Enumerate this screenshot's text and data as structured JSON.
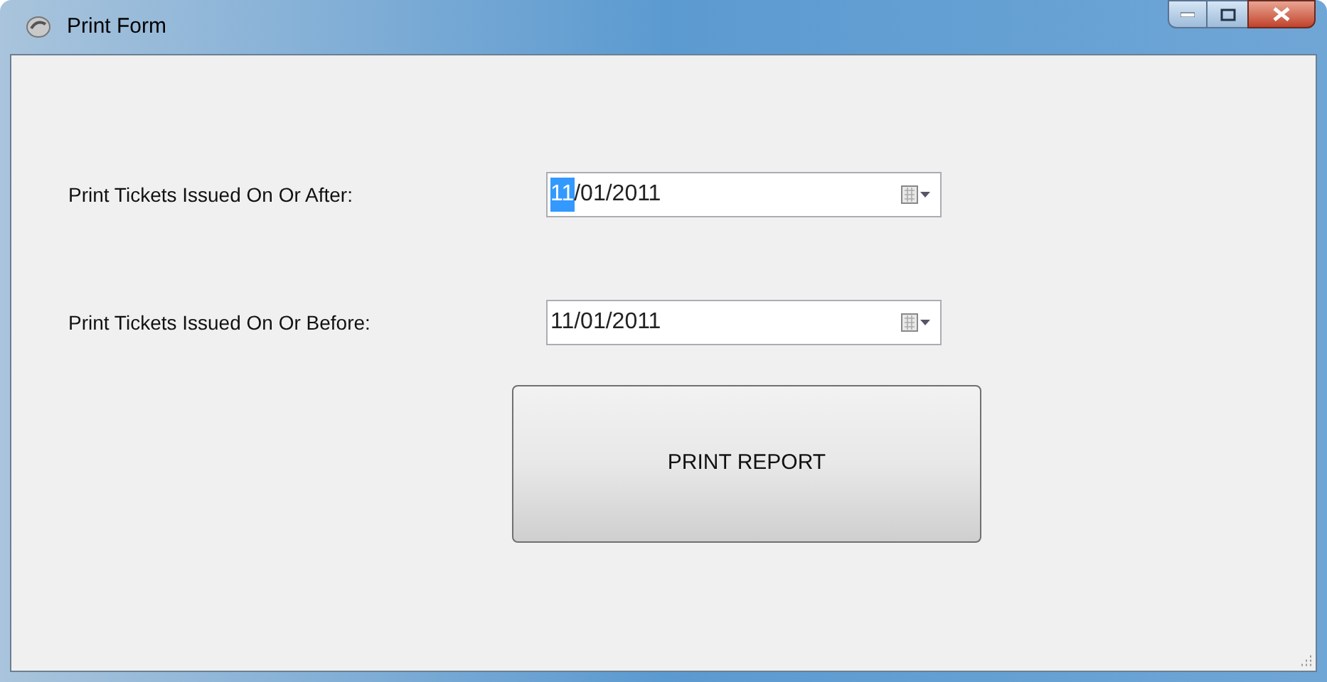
{
  "window": {
    "title": "Print Form"
  },
  "fields": [
    {
      "label": "Print Tickets Issued On Or After:",
      "value_parts": [
        {
          "text": "11",
          "selected": true
        },
        {
          "text": "/01/2011",
          "selected": false
        }
      ]
    },
    {
      "label": "Print Tickets Issued On Or Before:",
      "value_parts": [
        {
          "text": "11",
          "selected": false
        },
        {
          "text": "/01/2011",
          "selected": false
        }
      ]
    }
  ],
  "buttons": [
    "PRINT REPORT"
  ]
}
